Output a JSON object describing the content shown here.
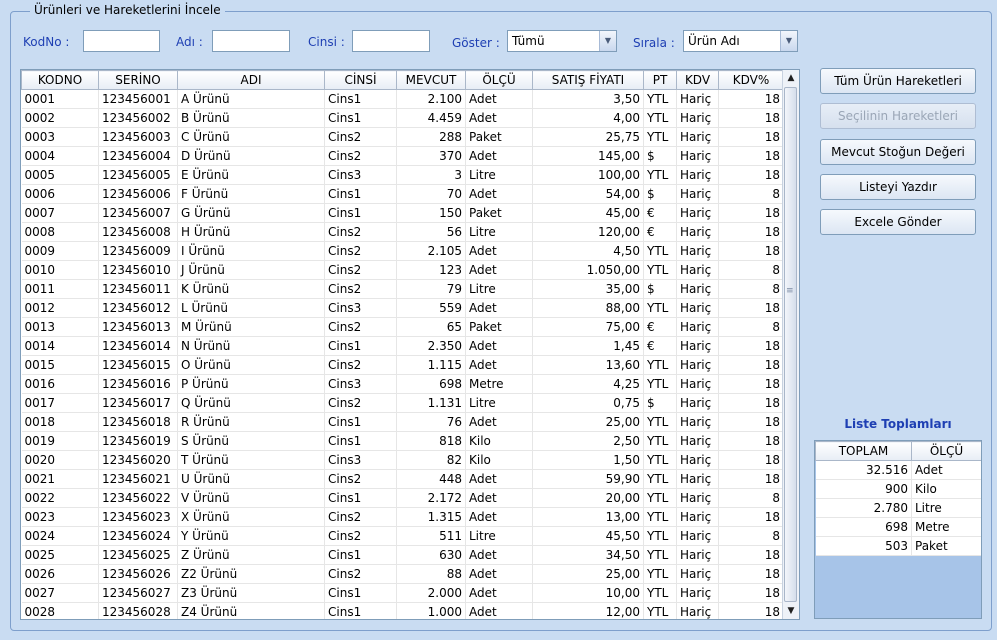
{
  "group": {
    "title": "Ürünleri ve Hareketlerini İncele"
  },
  "filters": {
    "kodno_label": "KodNo :",
    "kodno_value": "",
    "adi_label": "Adı :",
    "adi_value": "",
    "cinsi_label": "Cinsi :",
    "cinsi_value": "",
    "goster_label": "Göster :",
    "goster_value": "Tümü",
    "sirala_label": "Sırala :",
    "sirala_value": "Ürün Adı"
  },
  "grid": {
    "columns": [
      "KODNO",
      "SERİNO",
      "ADI",
      "CİNSİ",
      "MEVCUT",
      "ÖLÇÜ",
      "SATIŞ FİYATI",
      "PT",
      "KDV",
      "KDV%"
    ],
    "rows": [
      [
        "0001",
        "123456001",
        "A Ürünü",
        "Cins1",
        "2.100",
        "Adet",
        "3,50",
        "YTL",
        "Hariç",
        "18"
      ],
      [
        "0002",
        "123456002",
        "B Ürünü",
        "Cins1",
        "4.459",
        "Adet",
        "4,00",
        "YTL",
        "Hariç",
        "18"
      ],
      [
        "0003",
        "123456003",
        "C Ürünü",
        "Cins2",
        "288",
        "Paket",
        "25,75",
        "YTL",
        "Hariç",
        "18"
      ],
      [
        "0004",
        "123456004",
        "D Ürünü",
        "Cins2",
        "370",
        "Adet",
        "145,00",
        "$",
        "Hariç",
        "18"
      ],
      [
        "0005",
        "123456005",
        "E Ürünü",
        "Cins3",
        "3",
        "Litre",
        "100,00",
        "YTL",
        "Hariç",
        "18"
      ],
      [
        "0006",
        "123456006",
        "F Ürünü",
        "Cins1",
        "70",
        "Adet",
        "54,00",
        "$",
        "Hariç",
        "8"
      ],
      [
        "0007",
        "123456007",
        "G Ürünü",
        "Cins1",
        "150",
        "Paket",
        "45,00",
        "€",
        "Hariç",
        "18"
      ],
      [
        "0008",
        "123456008",
        "H Ürünü",
        "Cins2",
        "56",
        "Litre",
        "120,00",
        "€",
        "Hariç",
        "18"
      ],
      [
        "0009",
        "123456009",
        "I Ürünü",
        "Cins2",
        "2.105",
        "Adet",
        "4,50",
        "YTL",
        "Hariç",
        "18"
      ],
      [
        "0010",
        "123456010",
        "J Ürünü",
        "Cins2",
        "123",
        "Adet",
        "1.050,00",
        "YTL",
        "Hariç",
        "8"
      ],
      [
        "0011",
        "123456011",
        "K Ürünü",
        "Cins2",
        "79",
        "Litre",
        "35,00",
        "$",
        "Hariç",
        "8"
      ],
      [
        "0012",
        "123456012",
        "L Ürünü",
        "Cins3",
        "559",
        "Adet",
        "88,00",
        "YTL",
        "Hariç",
        "18"
      ],
      [
        "0013",
        "123456013",
        "M Ürünü",
        "Cins2",
        "65",
        "Paket",
        "75,00",
        "€",
        "Hariç",
        "8"
      ],
      [
        "0014",
        "123456014",
        "N Ürünü",
        "Cins1",
        "2.350",
        "Adet",
        "1,45",
        "€",
        "Hariç",
        "18"
      ],
      [
        "0015",
        "123456015",
        "O Ürünü",
        "Cins2",
        "1.115",
        "Adet",
        "13,60",
        "YTL",
        "Hariç",
        "18"
      ],
      [
        "0016",
        "123456016",
        "P Ürünü",
        "Cins3",
        "698",
        "Metre",
        "4,25",
        "YTL",
        "Hariç",
        "18"
      ],
      [
        "0017",
        "123456017",
        "Q Ürünü",
        "Cins2",
        "1.131",
        "Litre",
        "0,75",
        "$",
        "Hariç",
        "18"
      ],
      [
        "0018",
        "123456018",
        "R Ürünü",
        "Cins1",
        "76",
        "Adet",
        "25,00",
        "YTL",
        "Hariç",
        "18"
      ],
      [
        "0019",
        "123456019",
        "S Ürünü",
        "Cins1",
        "818",
        "Kilo",
        "2,50",
        "YTL",
        "Hariç",
        "18"
      ],
      [
        "0020",
        "123456020",
        "T Ürünü",
        "Cins3",
        "82",
        "Kilo",
        "1,50",
        "YTL",
        "Hariç",
        "18"
      ],
      [
        "0021",
        "123456021",
        "U Ürünü",
        "Cins2",
        "448",
        "Adet",
        "59,90",
        "YTL",
        "Hariç",
        "18"
      ],
      [
        "0022",
        "123456022",
        "V Ürünü",
        "Cins1",
        "2.172",
        "Adet",
        "20,00",
        "YTL",
        "Hariç",
        "8"
      ],
      [
        "0023",
        "123456023",
        "X Ürünü",
        "Cins2",
        "1.315",
        "Adet",
        "13,00",
        "YTL",
        "Hariç",
        "18"
      ],
      [
        "0024",
        "123456024",
        "Y Ürünü",
        "Cins2",
        "511",
        "Litre",
        "45,50",
        "YTL",
        "Hariç",
        "8"
      ],
      [
        "0025",
        "123456025",
        "Z Ürünü",
        "Cins1",
        "630",
        "Adet",
        "34,50",
        "YTL",
        "Hariç",
        "18"
      ],
      [
        "0026",
        "123456026",
        "Z2 Ürünü",
        "Cins2",
        "88",
        "Adet",
        "25,00",
        "YTL",
        "Hariç",
        "18"
      ],
      [
        "0027",
        "123456027",
        "Z3 Ürünü",
        "Cins1",
        "2.000",
        "Adet",
        "10,00",
        "YTL",
        "Hariç",
        "18"
      ],
      [
        "0028",
        "123456028",
        "Z4 Ürünü",
        "Cins1",
        "1.000",
        "Adet",
        "12,00",
        "YTL",
        "Hariç",
        "18"
      ]
    ]
  },
  "actions": {
    "all_movements": "Tüm Ürün Hareketleri",
    "selected_movements": "Seçilinin Hareketleri",
    "stock_value": "Mevcut Stoğun Değeri",
    "print_list": "Listeyi Yazdır",
    "export_excel": "Excele Gönder"
  },
  "totals": {
    "title": "Liste Toplamları",
    "columns": [
      "TOPLAM",
      "ÖLÇÜ"
    ],
    "rows": [
      [
        "32.516",
        "Adet"
      ],
      [
        "900",
        "Kilo"
      ],
      [
        "2.780",
        "Litre"
      ],
      [
        "698",
        "Metre"
      ],
      [
        "503",
        "Paket"
      ]
    ]
  },
  "colors": {
    "background": "#c9dcf2",
    "label_blue": "#1e3fb3",
    "totals_fill": "#a7c4e8"
  }
}
